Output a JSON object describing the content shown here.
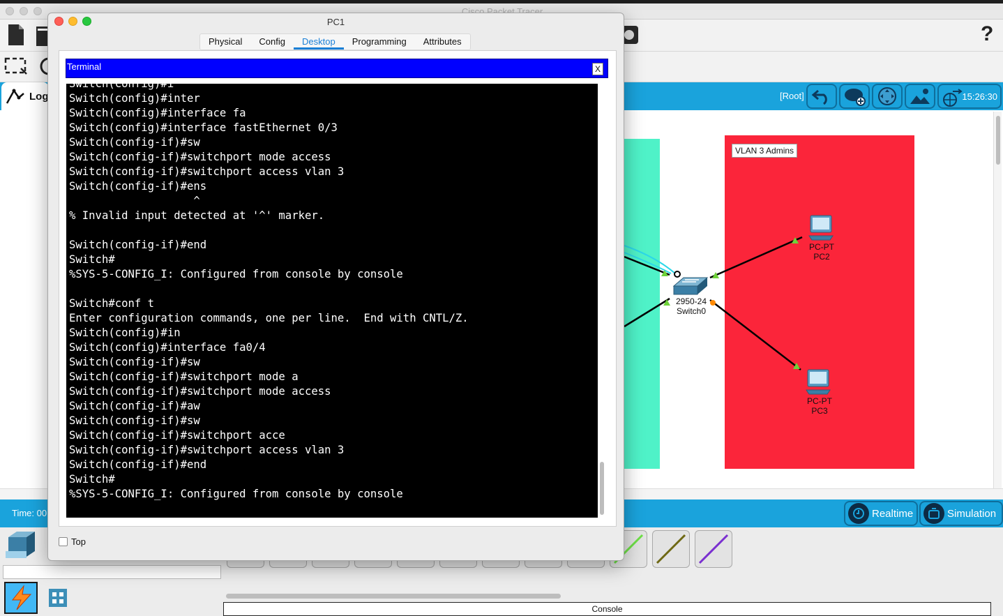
{
  "app": {
    "title": "Cisco Packet Tracer",
    "logical_tab_label": "Log",
    "root_label": "[Root]",
    "clock": "15:26:30",
    "time_label": "Time: 00",
    "realtime_label": "Realtime",
    "simulation_label": "Simulation",
    "console_label": "Console",
    "help_label": "?"
  },
  "workspace": {
    "vlan_label": "VLAN 3 Admins",
    "devices": [
      {
        "type": "PC-PT",
        "name": "PC2"
      },
      {
        "type": "PC-PT",
        "name": "PC3"
      },
      {
        "type": "2950-24",
        "name": "Switch0"
      }
    ],
    "colors": {
      "teal_zone": "#4ff2c8",
      "red_zone": "#fb253a",
      "accent": "#1aa3dc"
    }
  },
  "pc1": {
    "title": "PC1",
    "tabs": [
      "Physical",
      "Config",
      "Desktop",
      "Programming",
      "Attributes"
    ],
    "active_tab": "Desktop",
    "terminal_title": "Terminal",
    "terminal_close": "X",
    "top_checkbox_label": "Top",
    "terminal_lines": [
      "Switch(config)#i",
      "Switch(config)#inter",
      "Switch(config)#interface fa",
      "Switch(config)#interface fastEthernet 0/3",
      "Switch(config-if)#sw",
      "Switch(config-if)#switchport mode access",
      "Switch(config-if)#switchport access vlan 3",
      "Switch(config-if)#ens",
      "                   ^",
      "% Invalid input detected at '^' marker.",
      "",
      "Switch(config-if)#end",
      "Switch#",
      "%SYS-5-CONFIG_I: Configured from console by console",
      "",
      "Switch#conf t",
      "Enter configuration commands, one per line.  End with CNTL/Z.",
      "Switch(config)#in",
      "Switch(config)#interface fa0/4",
      "Switch(config-if)#sw",
      "Switch(config-if)#switchport mode a",
      "Switch(config-if)#switchport mode access",
      "Switch(config-if)#aw",
      "Switch(config-if)#sw",
      "Switch(config-if)#switchport acce",
      "Switch(config-if)#switchport access vlan 3",
      "Switch(config-if)#end",
      "Switch#",
      "%SYS-5-CONFIG_I: Configured from console by console"
    ]
  }
}
